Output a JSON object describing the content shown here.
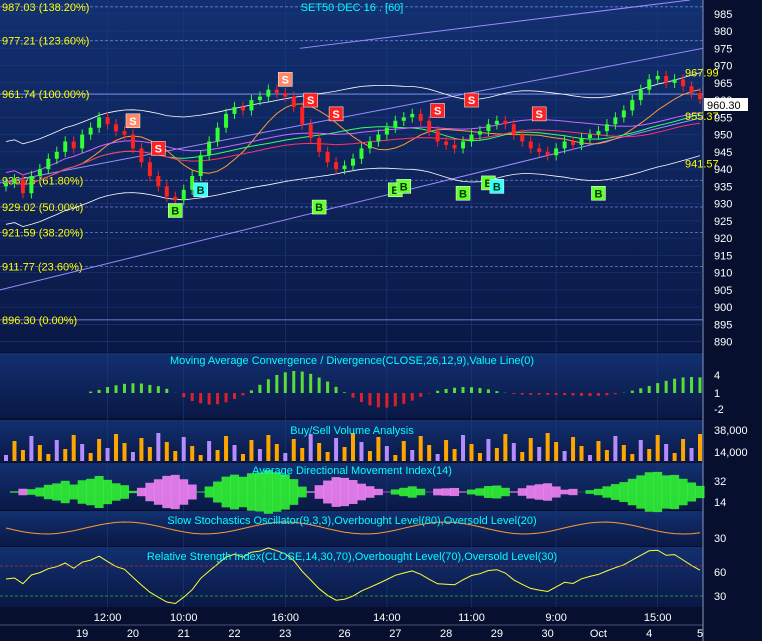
{
  "colors": {
    "background_top": "#0e1f5a",
    "background_bottom": "#0a1640",
    "fib_text": "#ffff00",
    "panel_title": "#00ffff",
    "axis_text": "#ffffff",
    "buy_label_bg": "#66ff33",
    "buy_label_alt_bg": "#33ffff",
    "sell_label_bg": "#ff2222",
    "sell_label_alt_bg": "#ff8866",
    "candle_up": "#33ff33",
    "candle_down": "#ff2222",
    "macd_pos": "#66ff33",
    "macd_neg": "#ff2222",
    "vol_buy": "#ffa500",
    "vol_sell": "#b38cff",
    "adx_pos": "#33ff33",
    "adx_neg": "#ff88ff"
  },
  "main": {
    "title": "SET50 DEC 16 . [60]",
    "last_price_badge": "960.30",
    "price_labels": [
      {
        "text": "967.99",
        "value": 967.99,
        "x_index": 82
      },
      {
        "text": "955.37",
        "value": 955.37,
        "x_index": 82
      },
      {
        "text": "941.57",
        "value": 941.57,
        "x_index": 82
      }
    ],
    "fib_levels": [
      {
        "label": "987.03 (138.20%)",
        "value": 987.03
      },
      {
        "label": "977.21 (123.60%)",
        "value": 977.21
      },
      {
        "label": "961.74 (100.00%)",
        "value": 961.74
      },
      {
        "label": "936.76 (61.80%)",
        "value": 936.76
      },
      {
        "label": "929.02 (50.00%)",
        "value": 929.02
      },
      {
        "label": "921.59 (38.20%)",
        "value": 921.59
      },
      {
        "label": "911.77 (23.60%)",
        "value": 911.77
      },
      {
        "label": "896.30 (0.00%)",
        "value": 896.3
      }
    ],
    "y_axis_ticks": [
      "985",
      "980",
      "975",
      "970",
      "965",
      "960",
      "955",
      "950",
      "945",
      "940",
      "935",
      "930",
      "925",
      "920",
      "915",
      "910",
      "905",
      "900",
      "895",
      "890"
    ],
    "ylim": [
      887,
      989
    ],
    "signals": [
      {
        "type": "S",
        "bar": 15,
        "value": 954,
        "alt": true
      },
      {
        "type": "S",
        "bar": 18,
        "value": 946,
        "alt": false
      },
      {
        "type": "B",
        "bar": 20,
        "value": 928,
        "alt": false
      },
      {
        "type": "B",
        "bar": 23,
        "value": 934,
        "alt": true
      },
      {
        "type": "S",
        "bar": 33,
        "value": 966,
        "alt": true
      },
      {
        "type": "S",
        "bar": 36,
        "value": 960,
        "alt": false
      },
      {
        "type": "S",
        "bar": 39,
        "value": 956,
        "alt": false
      },
      {
        "type": "B",
        "bar": 37,
        "value": 929,
        "alt": false
      },
      {
        "type": "B",
        "bar": 46,
        "value": 934,
        "alt": false
      },
      {
        "type": "B",
        "bar": 47,
        "value": 935,
        "alt": false
      },
      {
        "type": "S",
        "bar": 51,
        "value": 957,
        "alt": false
      },
      {
        "type": "S",
        "bar": 55,
        "value": 960,
        "alt": false
      },
      {
        "type": "B",
        "bar": 54,
        "value": 933,
        "alt": false
      },
      {
        "type": "B",
        "bar": 57,
        "value": 936,
        "alt": false
      },
      {
        "type": "B",
        "bar": 58,
        "value": 935,
        "alt": true
      },
      {
        "type": "S",
        "bar": 63,
        "value": 956,
        "alt": false
      },
      {
        "type": "B",
        "bar": 70,
        "value": 933,
        "alt": false
      }
    ]
  },
  "panels": {
    "macd": {
      "title": "Moving Average Convergence / Divergence(CLOSE,26,12,9),Value Line(0)",
      "ticks": [
        "4",
        "1",
        "-2"
      ]
    },
    "volume": {
      "title": "Buy/Sell Volume Analysis",
      "ticks": [
        "38,000",
        "14,000"
      ]
    },
    "adx": {
      "title": "Average Directional Movement Index(14)",
      "ticks": [
        "32",
        "14"
      ]
    },
    "stoch": {
      "title": "Slow Stochastics Oscillator(9,3,3),Overbought Level(80),Oversold Level(20)",
      "ticks": [
        "30"
      ]
    },
    "rsi": {
      "title": "Relative Strength Index(CLOSE,14,30,70),Overbought Level(70),Oversold Level(30)",
      "ticks": [
        "60",
        "30"
      ]
    }
  },
  "x_axis": {
    "times": [
      {
        "label": "12:00",
        "bar": 12
      },
      {
        "label": "10:00",
        "bar": 21
      },
      {
        "label": "16:00",
        "bar": 33
      },
      {
        "label": "14:00",
        "bar": 45
      },
      {
        "label": "11:00",
        "bar": 55
      },
      {
        "label": "9:00",
        "bar": 65
      },
      {
        "label": "15:00",
        "bar": 77
      }
    ],
    "dates": [
      {
        "label": "19",
        "bar": 9
      },
      {
        "label": "20",
        "bar": 15
      },
      {
        "label": "21",
        "bar": 21
      },
      {
        "label": "22",
        "bar": 27
      },
      {
        "label": "23",
        "bar": 33
      },
      {
        "label": "26",
        "bar": 40
      },
      {
        "label": "27",
        "bar": 46
      },
      {
        "label": "28",
        "bar": 52
      },
      {
        "label": "29",
        "bar": 58
      },
      {
        "label": "30",
        "bar": 64
      },
      {
        "label": "Oct",
        "bar": 70
      },
      {
        "label": "4",
        "bar": 76
      },
      {
        "label": "5",
        "bar": 82
      }
    ]
  },
  "chart_data": {
    "type": "line",
    "title": "SET50 DEC 16 . [60]",
    "x_unit": "hourly bars",
    "ylim": [
      887,
      989
    ],
    "series": [
      {
        "values": [
          936,
          937,
          933,
          938,
          940,
          943,
          945,
          948,
          946,
          950,
          952,
          955,
          953,
          951,
          950,
          946,
          942,
          938,
          935,
          932,
          931,
          934,
          938,
          944,
          948,
          952,
          956,
          958,
          957,
          960,
          961,
          963,
          962,
          961,
          958,
          953,
          949,
          945,
          942,
          940,
          941,
          943,
          946,
          948,
          950,
          952,
          954,
          955,
          956,
          954,
          951,
          948,
          947,
          946,
          948,
          950,
          951,
          953,
          954,
          953,
          950,
          948,
          946,
          945,
          944,
          946,
          948,
          947,
          949,
          950,
          951,
          953,
          955,
          957,
          960,
          963,
          966,
          967,
          965,
          966,
          964,
          962,
          960.3
        ]
      }
    ]
  }
}
